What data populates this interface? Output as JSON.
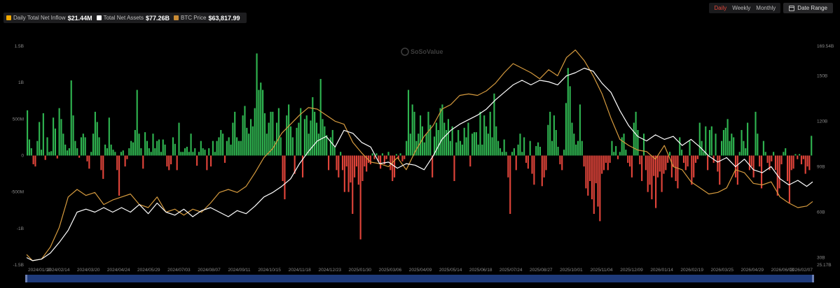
{
  "legend": {
    "items": [
      {
        "label": "Daily Total Net Inflow",
        "value": "$21.44M",
        "color": "#f2a900"
      },
      {
        "label": "Total Net Assets",
        "value": "$77.26B",
        "color": "#ffffff"
      },
      {
        "label": "BTC Price",
        "value": "$63,817.99",
        "color": "#c98b35"
      }
    ]
  },
  "toolbar": {
    "periods": [
      "Daily",
      "Weekly",
      "Monthly"
    ],
    "active_period": "Daily",
    "date_range_label": "Date Range"
  },
  "watermark": {
    "text": "SoSoValue"
  },
  "colors": {
    "inflow_positive": "#2fb450",
    "inflow_negative": "#e0443a",
    "total_net_assets": "#ffffff",
    "btc_price": "#d59a3e",
    "navigator_fill": "#1e3a7a"
  },
  "chart_data": {
    "type": "bar+line",
    "x_ticks": [
      "2024/01/10",
      "2024/02/14",
      "2024/03/20",
      "2024/04/24",
      "2024/05/29",
      "2024/07/03",
      "2024/08/07",
      "2024/09/11",
      "2024/10/15",
      "2024/11/18",
      "2024/12/23",
      "2025/01/30",
      "2025/03/06",
      "2025/04/09",
      "2025/05/14",
      "2025/06/18",
      "2025/07/24",
      "2025/08/27",
      "2025/10/01",
      "2025/11/04",
      "2025/12/09",
      "2026/01/14",
      "2026/02/19",
      "2026/03/25",
      "2026/04/29",
      "2026/06/03",
      "2026/02/07"
    ],
    "left_axis": {
      "ticks": [
        "1.5B",
        "1B",
        "500M",
        "0",
        "-500M",
        "-1B",
        "-1.5B"
      ],
      "values": [
        1.5,
        1,
        0.5,
        0,
        -0.5,
        -1,
        -1.5
      ],
      "ylim": [
        -1.5,
        1.5
      ],
      "unit": "B"
    },
    "right_axis": {
      "ticks": [
        "169.54B",
        "150B",
        "120B",
        "90B",
        "60B",
        "30B",
        "25.17B"
      ],
      "values": [
        169.54,
        150,
        120,
        90,
        60,
        30,
        25.17
      ],
      "ylim": [
        25.17,
        169.54
      ],
      "unit": "B"
    },
    "grid": false,
    "series": [
      {
        "name": "Daily Total Net Inflow",
        "type": "bar",
        "axis": "left",
        "unit": "USD billions",
        "values": [
          0.62,
          0.22,
          0.1,
          -0.12,
          -0.15,
          0.2,
          0.46,
          0.08,
          0.58,
          -0.06,
          0.25,
          0.05,
          0.06,
          0.52,
          0.37,
          -0.04,
          0.65,
          0.5,
          0.3,
          0.15,
          0.07,
          0.1,
          1.03,
          0.55,
          0.2,
          0.1,
          -0.03,
          0.25,
          0.3,
          0.25,
          -0.08,
          -0.18,
          0.05,
          0.3,
          0.6,
          0.46,
          0.25,
          -0.2,
          -0.32,
          0.15,
          0.1,
          0.52,
          0.15,
          0.08,
          0.05,
          -0.2,
          -0.55,
          0.05,
          0.07,
          -0.15,
          -0.05,
          0.1,
          0.2,
          0.18,
          0.35,
          0.9,
          0.3,
          0.1,
          -0.18,
          0.32,
          0.2,
          0.1,
          0.05,
          0.3,
          0.1,
          0.2,
          0.22,
          0.05,
          0.22,
          0.15,
          -0.15,
          -0.2,
          -0.12,
          0.25,
          0.16,
          -0.2,
          0.45,
          0.05,
          0.05,
          0.1,
          0.12,
          0.05,
          0.3,
          0.05,
          0.1,
          -0.14,
          0.05,
          0.2,
          0.1,
          0.08,
          -0.2,
          0.1,
          -0.15,
          0.2,
          0.05,
          0.2,
          0.25,
          0.35,
          0.3,
          -0.1,
          0.2,
          0.25,
          0.15,
          0.45,
          0.6,
          0.25,
          0.2,
          0.2,
          0.55,
          0.68,
          0.38,
          0.3,
          0.5,
          0.4,
          0.65,
          1.4,
          0.9,
          1.0,
          0.9,
          0.58,
          0.3,
          0.45,
          0.6,
          0.6,
          0.2,
          0.45,
          0.65,
          0.25,
          -0.35,
          -0.6,
          0.55,
          0.7,
          0.4,
          0.25,
          -0.25,
          0.38,
          0.45,
          0.65,
          -0.3,
          0.5,
          0.55,
          0.3,
          0.48,
          0.8,
          0.6,
          0.45,
          0.3,
          1.05,
          0.5,
          0.4,
          0.28,
          -0.2,
          0.25,
          0.35,
          0.12,
          -0.2,
          -0.3,
          0.05,
          -0.2,
          -0.5,
          -0.15,
          -0.5,
          -0.37,
          -0.8,
          -0.3,
          -0.15,
          -0.4,
          -1.15,
          -0.35,
          -0.15,
          -0.22,
          -0.1,
          -0.12,
          0.03,
          -0.05,
          0.03,
          -0.08,
          -0.18,
          0.03,
          -0.12,
          -0.05,
          0.05,
          -0.2,
          -0.35,
          -0.3,
          0.02,
          -0.05,
          0.03,
          -0.08,
          -0.05,
          0.2,
          0.9,
          0.3,
          0.7,
          0.6,
          0.2,
          0.3,
          0.55,
          0.4,
          0.18,
          0.3,
          0.6,
          0.42,
          -0.3,
          0.26,
          0.45,
          0.35,
          0.65,
          0.7,
          0.45,
          0.35,
          0.5,
          0.2,
          0.4,
          -0.35,
          0.18,
          0.35,
          0.2,
          0.15,
          0.38,
          0.25,
          0.45,
          -0.15,
          0.3,
          0.32,
          0.32,
          0.15,
          0.6,
          0.15,
          0.55,
          0.4,
          0.3,
          0.6,
          0.25,
          0.85,
          0.4,
          0.2,
          0.1,
          0.05,
          0.22,
          0.05,
          -0.3,
          -0.8,
          0.05,
          0.1,
          -0.2,
          0.15,
          0.3,
          0.05,
          0.25,
          -0.1,
          -0.18,
          0.2,
          -0.25,
          -0.4,
          0.13,
          0.18,
          0.12,
          -0.42,
          -0.3,
          -0.2,
          0.42,
          0.6,
          0.2,
          0.55,
          0.35,
          0.12,
          -0.12,
          -0.2,
          0.08,
          0.72,
          1.2,
          0.95,
          0.45,
          0.3,
          0.15,
          0.2,
          0.7,
          0.2,
          -0.15,
          -0.45,
          -0.55,
          -0.35,
          -0.6,
          -0.8,
          -0.38,
          -0.7,
          -0.9,
          -0.25,
          -0.2,
          -0.1,
          -0.2,
          -0.1,
          0.2,
          0.05,
          0.13,
          -0.05,
          0.05,
          0.25,
          0.3,
          0.08,
          -0.1,
          -0.15,
          -0.3,
          0.45,
          0.6,
          0.35,
          -0.12,
          -0.35,
          0.3,
          -0.2,
          -0.5,
          -0.4,
          -0.6,
          -0.28,
          -0.72,
          -0.3,
          -0.22,
          -0.5,
          -0.25,
          -0.2,
          -0.1,
          0.05,
          -0.3,
          -0.15,
          -0.35,
          -0.45,
          0.25,
          0.08,
          -0.1,
          -0.2,
          -0.15,
          0.2,
          -0.4,
          -0.3,
          -0.1,
          -0.05,
          0.45,
          0.2,
          0.05,
          0.4,
          -0.2,
          0.35,
          0.4,
          -0.1,
          0.3,
          -0.22,
          -0.4,
          0.2,
          0.35,
          0.38,
          0.5,
          0.2,
          0.3,
          0.25,
          -0.3,
          -0.4,
          0.05,
          0.35,
          0.2,
          0.1,
          0.45,
          -0.2,
          -0.15,
          -0.3,
          0.6,
          0.3,
          -0.15,
          -0.45,
          0.2,
          0.05,
          -0.1,
          -0.2,
          -0.08,
          0.05,
          -0.2,
          -0.55,
          -0.45,
          -0.12,
          0.05,
          0.1,
          -0.35,
          -0.65,
          -0.2,
          -0.18,
          0.02,
          -0.05,
          0.02,
          -0.12,
          -0.05,
          -0.25,
          -0.15,
          -0.2,
          0.27
        ]
      },
      {
        "name": "Total Net Assets",
        "type": "line",
        "axis": "right",
        "unit": "USD billions",
        "points": [
          [
            0,
            30
          ],
          [
            4,
            28
          ],
          [
            10,
            29
          ],
          [
            16,
            33
          ],
          [
            22,
            40
          ],
          [
            28,
            48
          ],
          [
            34,
            60
          ],
          [
            40,
            62
          ],
          [
            46,
            60
          ],
          [
            52,
            63
          ],
          [
            58,
            60
          ],
          [
            64,
            63
          ],
          [
            70,
            60
          ],
          [
            76,
            65
          ],
          [
            82,
            59
          ],
          [
            88,
            66
          ],
          [
            94,
            60
          ],
          [
            100,
            58
          ],
          [
            106,
            62
          ],
          [
            112,
            57
          ],
          [
            118,
            61
          ],
          [
            124,
            63
          ],
          [
            130,
            60
          ],
          [
            136,
            57
          ],
          [
            142,
            61
          ],
          [
            148,
            59
          ],
          [
            154,
            64
          ],
          [
            160,
            70
          ],
          [
            166,
            73
          ],
          [
            172,
            77
          ],
          [
            178,
            82
          ],
          [
            184,
            92
          ],
          [
            190,
            100
          ],
          [
            196,
            107
          ],
          [
            202,
            110
          ],
          [
            208,
            103
          ],
          [
            214,
            114
          ],
          [
            220,
            112
          ],
          [
            226,
            106
          ],
          [
            232,
            103
          ],
          [
            238,
            92
          ],
          [
            244,
            93
          ],
          [
            250,
            89
          ],
          [
            256,
            92
          ],
          [
            262,
            91
          ],
          [
            268,
            88
          ],
          [
            274,
            97
          ],
          [
            280,
            108
          ],
          [
            286,
            114
          ],
          [
            292,
            118
          ],
          [
            298,
            121
          ],
          [
            304,
            124
          ],
          [
            310,
            128
          ],
          [
            316,
            134
          ],
          [
            322,
            139
          ],
          [
            328,
            144
          ],
          [
            334,
            147
          ],
          [
            340,
            144
          ],
          [
            346,
            147
          ],
          [
            352,
            146
          ],
          [
            358,
            144
          ],
          [
            364,
            150
          ],
          [
            370,
            152
          ],
          [
            376,
            155
          ],
          [
            382,
            153
          ],
          [
            388,
            145
          ],
          [
            394,
            139
          ],
          [
            400,
            127
          ],
          [
            406,
            117
          ],
          [
            412,
            110
          ],
          [
            418,
            107
          ],
          [
            424,
            111
          ],
          [
            430,
            108
          ],
          [
            436,
            110
          ],
          [
            442,
            104
          ],
          [
            448,
            108
          ],
          [
            454,
            103
          ],
          [
            460,
            97
          ],
          [
            466,
            93
          ],
          [
            472,
            96
          ],
          [
            478,
            90
          ],
          [
            484,
            95
          ],
          [
            490,
            88
          ],
          [
            496,
            86
          ],
          [
            502,
            90
          ],
          [
            508,
            82
          ],
          [
            514,
            78
          ],
          [
            520,
            81
          ],
          [
            526,
            77
          ],
          [
            530,
            80
          ]
        ]
      },
      {
        "name": "BTC Price",
        "type": "line",
        "axis": "right",
        "unit": "index",
        "points": [
          [
            0,
            32
          ],
          [
            4,
            28
          ],
          [
            10,
            29
          ],
          [
            16,
            37
          ],
          [
            22,
            50
          ],
          [
            28,
            70
          ],
          [
            34,
            75
          ],
          [
            40,
            71
          ],
          [
            46,
            73
          ],
          [
            52,
            65
          ],
          [
            58,
            68
          ],
          [
            64,
            70
          ],
          [
            70,
            72
          ],
          [
            76,
            65
          ],
          [
            82,
            63
          ],
          [
            88,
            70
          ],
          [
            94,
            60
          ],
          [
            100,
            62
          ],
          [
            106,
            58
          ],
          [
            112,
            62
          ],
          [
            118,
            60
          ],
          [
            124,
            66
          ],
          [
            130,
            73
          ],
          [
            136,
            75
          ],
          [
            142,
            73
          ],
          [
            148,
            77
          ],
          [
            154,
            86
          ],
          [
            160,
            96
          ],
          [
            166,
            102
          ],
          [
            172,
            112
          ],
          [
            178,
            118
          ],
          [
            184,
            124
          ],
          [
            190,
            129
          ],
          [
            196,
            128
          ],
          [
            202,
            124
          ],
          [
            208,
            120
          ],
          [
            214,
            118
          ],
          [
            220,
            106
          ],
          [
            226,
            99
          ],
          [
            232,
            93
          ],
          [
            238,
            92
          ],
          [
            244,
            90
          ],
          [
            250,
            96
          ],
          [
            256,
            88
          ],
          [
            262,
            100
          ],
          [
            268,
            110
          ],
          [
            274,
            117
          ],
          [
            280,
            128
          ],
          [
            286,
            131
          ],
          [
            292,
            137
          ],
          [
            298,
            138
          ],
          [
            304,
            137
          ],
          [
            310,
            140
          ],
          [
            316,
            145
          ],
          [
            322,
            152
          ],
          [
            328,
            158
          ],
          [
            334,
            155
          ],
          [
            340,
            152
          ],
          [
            346,
            148
          ],
          [
            352,
            154
          ],
          [
            358,
            150
          ],
          [
            364,
            162
          ],
          [
            370,
            167
          ],
          [
            376,
            160
          ],
          [
            382,
            150
          ],
          [
            388,
            138
          ],
          [
            394,
            122
          ],
          [
            400,
            108
          ],
          [
            406,
            104
          ],
          [
            412,
            101
          ],
          [
            418,
            100
          ],
          [
            424,
            95
          ],
          [
            430,
            104
          ],
          [
            436,
            90
          ],
          [
            442,
            88
          ],
          [
            448,
            80
          ],
          [
            454,
            76
          ],
          [
            460,
            72
          ],
          [
            466,
            73
          ],
          [
            472,
            76
          ],
          [
            478,
            88
          ],
          [
            484,
            86
          ],
          [
            490,
            79
          ],
          [
            496,
            78
          ],
          [
            502,
            80
          ],
          [
            508,
            70
          ],
          [
            514,
            66
          ],
          [
            520,
            63
          ],
          [
            526,
            64
          ],
          [
            530,
            67
          ]
        ]
      }
    ]
  }
}
